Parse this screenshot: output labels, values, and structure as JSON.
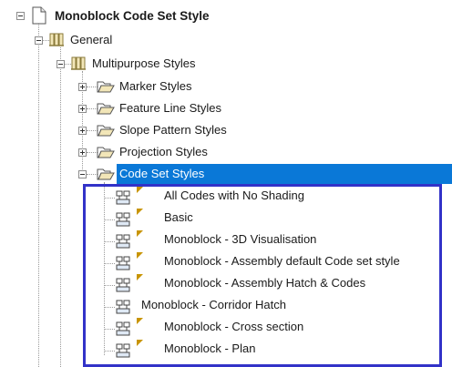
{
  "tree": {
    "root": {
      "label": "Monoblock Code Set Style"
    },
    "general": {
      "label": "General"
    },
    "multipurpose": {
      "label": "Multipurpose Styles"
    },
    "folders": [
      {
        "label": "Marker Styles"
      },
      {
        "label": "Feature Line Styles"
      },
      {
        "label": "Slope Pattern Styles"
      },
      {
        "label": "Projection Styles"
      },
      {
        "label": "Code Set Styles"
      }
    ],
    "code_set_styles": [
      {
        "label": "All Codes with No Shading",
        "flag": true
      },
      {
        "label": "Basic",
        "flag": true
      },
      {
        "label": "Monoblock - 3D Visualisation",
        "flag": true
      },
      {
        "label": "Monoblock - Assembly default Code set style",
        "flag": true
      },
      {
        "label": "Monoblock - Assembly Hatch & Codes",
        "flag": true
      },
      {
        "label": "Monoblock - Corridor Hatch",
        "flag": false
      },
      {
        "label": "Monoblock - Cross section",
        "flag": true
      },
      {
        "label": "Monoblock - Plan",
        "flag": true
      }
    ]
  },
  "colors": {
    "selection": "#0a78d7",
    "highlight_border": "#3232c8",
    "folder_fill": "#f2e6b8",
    "flag": "#c89400"
  }
}
